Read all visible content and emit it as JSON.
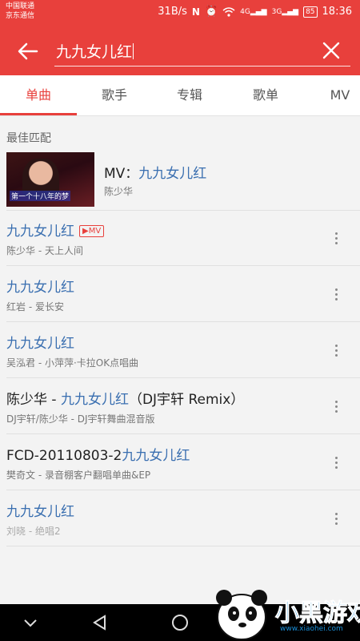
{
  "status_bar": {
    "carrier_1": "中国联通",
    "carrier_2": "京东通信",
    "speed": "31B/s",
    "network_4g": "4G",
    "network_3g": "3G",
    "battery": "85",
    "time": "18:36"
  },
  "search": {
    "query": "九九女儿红",
    "back_icon": "arrow-left-icon",
    "clear_icon": "close-icon"
  },
  "tabs": [
    {
      "label": "单曲",
      "active": true
    },
    {
      "label": "歌手",
      "active": false
    },
    {
      "label": "专辑",
      "active": false
    },
    {
      "label": "歌单",
      "active": false
    },
    {
      "label": "MV",
      "active": false
    }
  ],
  "best_match": {
    "section_label": "最佳匹配",
    "prefix": "MV：",
    "title": "九九女儿红",
    "artist": "陈少华",
    "thumbnail_caption": "第一个十八年的梦"
  },
  "songs": [
    {
      "title_prefix": "",
      "title_highlight": "九九女儿红",
      "title_suffix": "",
      "badge": "▶MV",
      "subtitle": "陈少华 - 天上人间"
    },
    {
      "title_prefix": "",
      "title_highlight": "九九女儿红",
      "title_suffix": "",
      "badge": "",
      "subtitle": "红岩 - 爱长安"
    },
    {
      "title_prefix": "",
      "title_highlight": "九九女儿红",
      "title_suffix": "",
      "badge": "",
      "subtitle": "吴泓君 - 小萍萍·卡拉OK点唱曲"
    },
    {
      "title_prefix": "陈少华 - ",
      "title_highlight": "九九女儿红",
      "title_suffix": "（DJ宇轩 Remix）",
      "badge": "",
      "subtitle": "DJ宇轩/陈少华 - DJ宇轩舞曲混音版"
    },
    {
      "title_prefix": "FCD-20110803-2",
      "title_highlight": "九九女儿红",
      "title_suffix": "",
      "badge": "",
      "subtitle": "樊奇文 - 录音棚客户翻唱单曲&EP"
    },
    {
      "title_prefix": "",
      "title_highlight": "九九女儿红",
      "title_suffix": "",
      "badge": "",
      "subtitle": "刘晓 - 绝唱2"
    }
  ],
  "watermark": {
    "text": "小黑游戏",
    "url": "www.xiaohei.com"
  },
  "colors": {
    "accent": "#e8403c",
    "highlight": "#3a6fb0"
  }
}
